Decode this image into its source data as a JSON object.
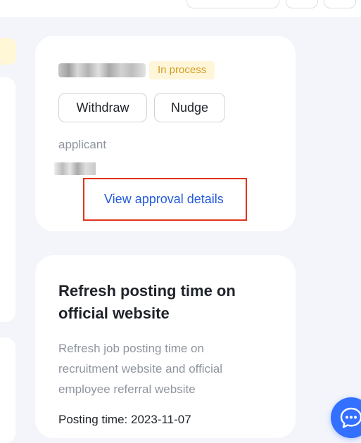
{
  "approval_card": {
    "status_badge": "In process",
    "withdraw_label": "Withdraw",
    "nudge_label": "Nudge",
    "applicant_label": "applicant",
    "view_details_label": "View approval details"
  },
  "task_card": {
    "title": "Refresh posting time on official website",
    "description": "Refresh job posting time on recruitment website and official employee referral website",
    "posting_time": "Posting time: 2023-11-07"
  },
  "icons": {
    "chat_fab": "chat-bubble-icon"
  },
  "colors": {
    "background": "#f3f5fb",
    "link": "#245bdb",
    "status_text": "#d39a22",
    "status_bg": "#fff6d9",
    "highlight": "#e0341b",
    "fab": "#3370ff"
  }
}
